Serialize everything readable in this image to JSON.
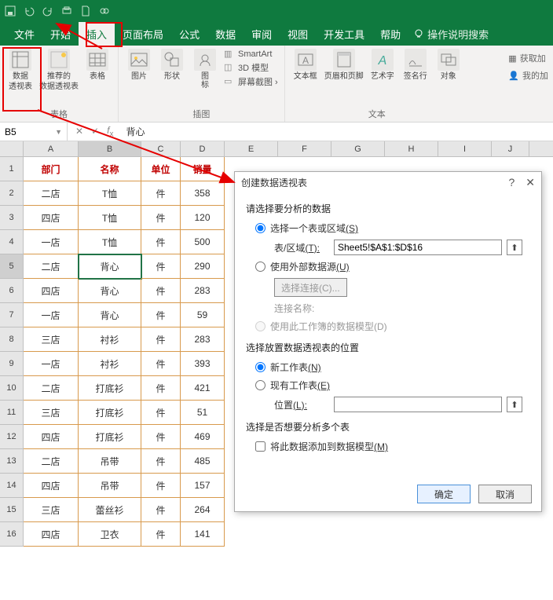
{
  "menus": {
    "file": "文件",
    "home": "开始",
    "insert": "插入",
    "layout": "页面布局",
    "formula": "公式",
    "data": "数据",
    "review": "审阅",
    "view": "视图",
    "dev": "开发工具",
    "help": "帮助",
    "tellme": "操作说明搜索"
  },
  "ribbon": {
    "groups": {
      "tables": "表格",
      "illustrations": "插图",
      "text": "文本"
    },
    "btn": {
      "pivot": "数据",
      "pivot2": "透视表",
      "recpivot": "推荐的",
      "recpivot2": "数据透视表",
      "table": "表格",
      "pic": "图片",
      "shapes": "形状",
      "icons": "图\n标",
      "smartart": "SmartArt",
      "model3d": "3D 模型",
      "screenshot": "屏幕截图 ›",
      "textbox": "文本框",
      "headerfooter": "页眉和页脚",
      "wordart": "艺术字",
      "sigline": "签名行",
      "object": "对象"
    },
    "right": {
      "addin": "获取加",
      "myaddin": "我的加"
    }
  },
  "namebox": "B5",
  "formula_value": "背心",
  "columns": [
    "A",
    "B",
    "C",
    "D",
    "E",
    "F",
    "G",
    "H",
    "I",
    "J"
  ],
  "headers": {
    "dept": "部门",
    "name": "名称",
    "unit": "单位",
    "sales": "销量"
  },
  "rows": [
    {
      "a": "二店",
      "b": "T恤",
      "c": "件",
      "d": "358"
    },
    {
      "a": "四店",
      "b": "T恤",
      "c": "件",
      "d": "120"
    },
    {
      "a": "一店",
      "b": "T恤",
      "c": "件",
      "d": "500"
    },
    {
      "a": "二店",
      "b": "背心",
      "c": "件",
      "d": "290"
    },
    {
      "a": "四店",
      "b": "背心",
      "c": "件",
      "d": "283"
    },
    {
      "a": "一店",
      "b": "背心",
      "c": "件",
      "d": "59"
    },
    {
      "a": "三店",
      "b": "衬衫",
      "c": "件",
      "d": "283"
    },
    {
      "a": "一店",
      "b": "衬衫",
      "c": "件",
      "d": "393"
    },
    {
      "a": "二店",
      "b": "打底衫",
      "c": "件",
      "d": "421"
    },
    {
      "a": "三店",
      "b": "打底衫",
      "c": "件",
      "d": "51"
    },
    {
      "a": "四店",
      "b": "打底衫",
      "c": "件",
      "d": "469"
    },
    {
      "a": "二店",
      "b": "吊带",
      "c": "件",
      "d": "485"
    },
    {
      "a": "四店",
      "b": "吊带",
      "c": "件",
      "d": "157"
    },
    {
      "a": "三店",
      "b": "蕾丝衫",
      "c": "件",
      "d": "264"
    },
    {
      "a": "四店",
      "b": "卫衣",
      "c": "件",
      "d": "141"
    }
  ],
  "dialog": {
    "title": "创建数据透视表",
    "sect1": "请选择要分析的数据",
    "opt_range": "选择一个表或区域",
    "range_label": "表/区域",
    "range_value": "Sheet5!$A$1:$D$16",
    "opt_ext": "使用外部数据源",
    "choose_conn": "选择连接(C)...",
    "conn_name": "连接名称:",
    "opt_model": "使用此工作簿的数据模型(D)",
    "sect2": "选择放置数据透视表的位置",
    "opt_new": "新工作表",
    "opt_exist": "现有工作表",
    "loc_label": "位置",
    "sect3": "选择是否想要分析多个表",
    "chk_add": "将此数据添加到数据模型",
    "ok": "确定",
    "cancel": "取消",
    "key_s": "(S)",
    "key_t": "(T):",
    "key_u": "(U)",
    "key_n": "(N)",
    "key_e": "(E)",
    "key_l": "(L):",
    "key_m": "(M)"
  }
}
